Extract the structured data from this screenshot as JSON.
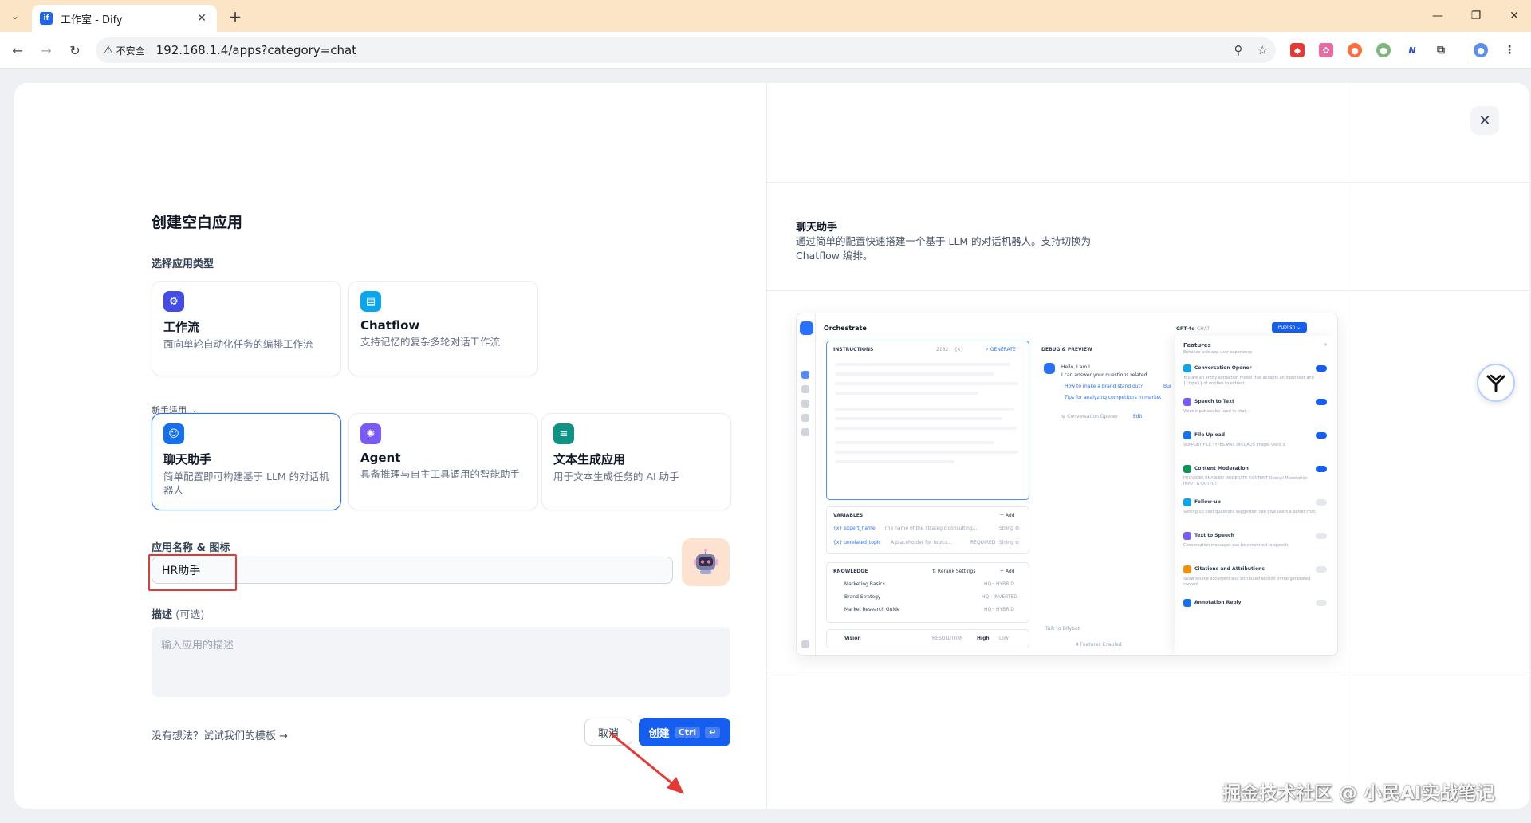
{
  "browser": {
    "tab_title": "工作室 - Dify",
    "tab_favicon_text": "if",
    "insecure_label": "不安全",
    "url": "192.168.1.4/apps?category=chat"
  },
  "modal": {
    "title": "创建空白应用",
    "section_label": "选择应用类型",
    "types": [
      {
        "title": "工作流",
        "desc": "面向单轮自动化任务的编排工作流",
        "color": "#444ce7"
      },
      {
        "title": "Chatflow",
        "desc": "支持记忆的复杂多轮对话工作流",
        "color": "#0ba5ec"
      }
    ],
    "beginner_label": "新手适用",
    "beginner_types": [
      {
        "title": "聊天助手",
        "desc": "简单配置即可构建基于 LLM 的对话机器人",
        "color": "#1570ef",
        "selected": true
      },
      {
        "title": "Agent",
        "desc": "具备推理与自主工具调用的智能助手",
        "color": "#7a5af8",
        "selected": false
      },
      {
        "title": "文本生成应用",
        "desc": "用于文本生成任务的 AI 助手",
        "color": "#0e9384",
        "selected": false
      }
    ],
    "name_label": "应用名称 & 图标",
    "name_value": "HR助手",
    "desc_label": "描述",
    "desc_optional": "(可选)",
    "desc_placeholder": "输入应用的描述",
    "template_link": "没有想法？试试我们的模板 →",
    "cancel_label": "取消",
    "create_label": "创建",
    "create_kbd": "Ctrl",
    "create_kbd_enter": "↵"
  },
  "preview": {
    "title": "聊天助手",
    "desc": "通过简单的配置快速搭建一个基于 LLM 的对话机器人。支持切换为 Chatflow 编排。",
    "shot": {
      "header": "Orchestrate",
      "model": "GPT-4o",
      "model_tag": "CHAT",
      "publish": "Publish ⌄",
      "instructions": "INSTRUCTIONS",
      "instr_count": "2182",
      "instr_braces": "{x}",
      "generate": "✧ GENERATE",
      "debug": "DEBUG & PREVIEW",
      "hello1": "Hello, I am I.",
      "hello2": "I can answer your questions related",
      "q1": "How to make a brand stand out?",
      "q1b": "Bui",
      "q2": "Tips for analyzing competitors in market",
      "opener": "⚙ Conversation Opener",
      "edit": "Edit",
      "talk": "Talk to Difybot",
      "features_enabled": "4 Features Enabled",
      "variables": "VARIABLES",
      "add": "+ Add",
      "var1_name": "{x} expert_name",
      "var1_desc": "The name of the strategic consulting...",
      "var1_type": "String ⚙",
      "var2_name": "{x} unrelated_topic",
      "var2_desc": "A placeholder for topics...",
      "var2_req": "REQUIRED",
      "var2_type": "String ⚙",
      "knowledge": "KNOWLEDGE",
      "rerank": "⇅ Rerank Settings",
      "kb1": "Marketing Basics",
      "kb1_tag": "HQ · HYBRID",
      "kb2": "Brand Strategy",
      "kb2_tag": "HQ · INVERTED",
      "kb3": "Market Research Guide",
      "kb3_tag": "HQ · HYBRID",
      "vision": "Vision",
      "resolution": "RESOLUTION",
      "high": "High",
      "low": "Low",
      "features_title": "Features",
      "features_sub": "Enhance web app user experience",
      "features_close": "×",
      "features": [
        {
          "name": "Conversation Opener",
          "sub": "You are an entity extraction model that accepts an input text and {{type}} of entities to extract.",
          "color": "#0ba5ec",
          "on": true
        },
        {
          "name": "Speech to Text",
          "sub": "Voice input can be used in chat.",
          "color": "#7a5af8",
          "on": true
        },
        {
          "name": "File Upload",
          "sub": "SUPPORT FILE TYPES   MAX UPLOADS   Image, Docs   3",
          "color": "#1570ef",
          "on": true
        },
        {
          "name": "Content Moderation",
          "sub": "PROVIDER   ENABLED MODERATE CONTENT   OpenAI Moderation   INPUT & OUTPUT",
          "color": "#079455",
          "on": true
        },
        {
          "name": "Follow-up",
          "sub": "Setting up next questions suggestion can give users a better chat.",
          "color": "#0ba5ec",
          "on": false
        },
        {
          "name": "Text to Speech",
          "sub": "Conversation messages can be converted to speech.",
          "color": "#7a5af8",
          "on": false
        },
        {
          "name": "Citations and Attributions",
          "sub": "Show source document and attributed section of the generated content.",
          "color": "#f79009",
          "on": false
        },
        {
          "name": "Annotation Reply",
          "sub": "",
          "color": "#1570ef",
          "on": false
        }
      ]
    }
  },
  "watermark": "掘金技术社区 @ 小民AI实战笔记"
}
